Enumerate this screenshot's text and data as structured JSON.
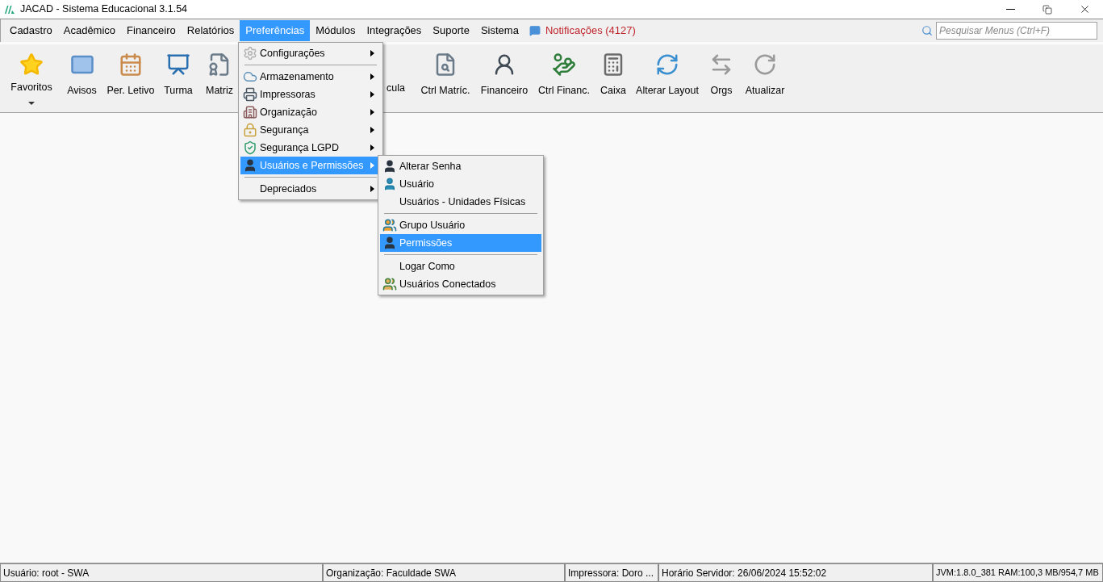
{
  "window": {
    "title": "JACAD - Sistema Educacional 3.1.54"
  },
  "menubar": {
    "items": [
      {
        "label": "Cadastro",
        "selected": false
      },
      {
        "label": "Acadêmico",
        "selected": false
      },
      {
        "label": "Financeiro",
        "selected": false
      },
      {
        "label": "Relatórios",
        "selected": false
      },
      {
        "label": "Preferências",
        "selected": true
      },
      {
        "label": "Módulos",
        "selected": false
      },
      {
        "label": "Integrações",
        "selected": false
      },
      {
        "label": "Suporte",
        "selected": false
      },
      {
        "label": "Sistema",
        "selected": false
      }
    ],
    "notifications": {
      "label": "Notificações (4127)"
    },
    "search": {
      "placeholder": "Pesquisar Menus (Ctrl+F)"
    }
  },
  "toolbar": {
    "items": [
      {
        "label": "Favoritos",
        "kind": "dropdown"
      },
      {
        "label": "Avisos",
        "kind": "button"
      },
      {
        "label": "Per. Letivo",
        "kind": "button"
      },
      {
        "label": "Turma",
        "kind": "button"
      },
      {
        "label": "Matriz",
        "kind": "button"
      },
      {
        "label": "cula",
        "kind": "partial"
      },
      {
        "label": "Ctrl Matríc.",
        "kind": "button"
      },
      {
        "label": "Financeiro",
        "kind": "button"
      },
      {
        "label": "Ctrl Financ.",
        "kind": "button"
      },
      {
        "label": "Caixa",
        "kind": "button"
      },
      {
        "label": "Alterar Layout",
        "kind": "button"
      },
      {
        "label": "Orgs",
        "kind": "button"
      },
      {
        "label": "Atualizar",
        "kind": "button"
      }
    ]
  },
  "menu": {
    "items": [
      {
        "kind": "item",
        "label": "Configurações",
        "submenu": true,
        "selected": false
      },
      {
        "kind": "separator"
      },
      {
        "kind": "item",
        "label": "Armazenamento",
        "submenu": true,
        "selected": false
      },
      {
        "kind": "item",
        "label": "Impressoras",
        "submenu": true,
        "selected": false
      },
      {
        "kind": "item",
        "label": "Organização",
        "submenu": true,
        "selected": false
      },
      {
        "kind": "item",
        "label": "Segurança",
        "submenu": true,
        "selected": false
      },
      {
        "kind": "item",
        "label": "Segurança LGPD",
        "submenu": true,
        "selected": false
      },
      {
        "kind": "item",
        "label": "Usuários e Permissões",
        "submenu": true,
        "selected": true
      },
      {
        "kind": "separator"
      },
      {
        "kind": "item",
        "label": "Depreciados",
        "submenu": true,
        "selected": false
      }
    ]
  },
  "submenu": {
    "items": [
      {
        "kind": "item",
        "label": "Alterar Senha",
        "selected": false
      },
      {
        "kind": "item",
        "label": "Usuário",
        "selected": false
      },
      {
        "kind": "item",
        "label": "Usuários - Unidades Físicas",
        "selected": false
      },
      {
        "kind": "separator"
      },
      {
        "kind": "item",
        "label": "Grupo Usuário",
        "selected": false
      },
      {
        "kind": "item",
        "label": "Permissões",
        "selected": true
      },
      {
        "kind": "separator"
      },
      {
        "kind": "item",
        "label": "Logar Como",
        "selected": false
      },
      {
        "kind": "item",
        "label": "Usuários Conectados",
        "selected": false
      }
    ]
  },
  "status_bar": [
    "Usuário: root - SWA",
    "Organização: Faculdade SWA",
    "Impressora: Doro ...",
    "Horário Servidor: 26/06/2024 15:52:02",
    "JVM:1.8.0_381  RAM:100,3 MB/954,7 MB"
  ]
}
